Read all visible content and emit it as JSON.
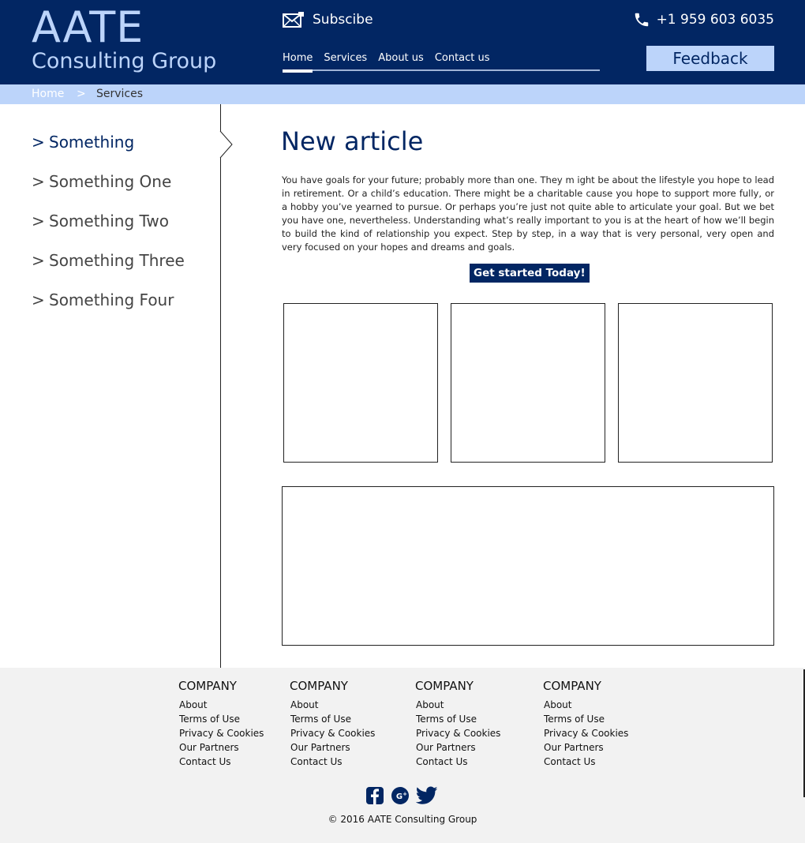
{
  "header": {
    "logo_main": "AATE",
    "logo_sub": "Consulting Group",
    "subscribe_label": "Subscibe",
    "phone": "+1 959 603 6035",
    "feedback_label": "Feedback",
    "nav": [
      {
        "label": "Home",
        "active": true
      },
      {
        "label": "Services",
        "active": false
      },
      {
        "label": "About us",
        "active": false
      },
      {
        "label": "Contact us",
        "active": false
      }
    ],
    "icons": {
      "subscribe": "mail-icon",
      "phone": "phone-icon"
    }
  },
  "breadcrumb": {
    "home": "Home",
    "separator": ">",
    "current": "Services"
  },
  "sidebar": {
    "chevron": ">",
    "items": [
      {
        "label": "Something",
        "active": true
      },
      {
        "label": "Something One",
        "active": false
      },
      {
        "label": "Something Two",
        "active": false
      },
      {
        "label": "Something Three",
        "active": false
      },
      {
        "label": "Something Four",
        "active": false
      }
    ]
  },
  "main": {
    "title": "New article",
    "body": "You have goals for your future; probably more than one. They m ight be about the lifestyle you hope to lead in retirement. Or a child’s education. There might be a charitable cause you hope to support more fully, or a hobby you’ve yearned to pursue. Or perhaps you’re just not quite able to articulate your goal. But we bet you have one, nevertheless. Understanding what’s really important to you is at the heart of how we’ll begin to build the kind of relationship you expect. Step by step, in a way that is very personal, very open and very focused on your hopes and dreams and goals.",
    "cta_label": "Get started Today!"
  },
  "footer": {
    "columns": [
      {
        "heading": "COMPANY",
        "links": [
          "About",
          "Terms of Use",
          "Privacy & Cookies",
          "Our Partners",
          "Contact Us"
        ]
      },
      {
        "heading": "COMPANY",
        "links": [
          "About",
          "Terms of Use",
          "Privacy & Cookies",
          "Our Partners",
          "Contact Us"
        ]
      },
      {
        "heading": "COMPANY",
        "links": [
          "About",
          "Terms of Use",
          "Privacy & Cookies",
          "Our Partners",
          "Contact Us"
        ]
      },
      {
        "heading": "COMPANY",
        "links": [
          "About",
          "Terms of Use",
          "Privacy & Cookies",
          "Our Partners",
          "Contact Us"
        ]
      }
    ],
    "social_icons": [
      "facebook-icon",
      "google-plus-icon",
      "twitter-icon"
    ],
    "copyright": "© 2016 AATE Consulting Group"
  },
  "colors": {
    "brand_dark": "#022663",
    "brand_light": "#bcd4fa",
    "footer_bg": "#f2f2f2"
  }
}
